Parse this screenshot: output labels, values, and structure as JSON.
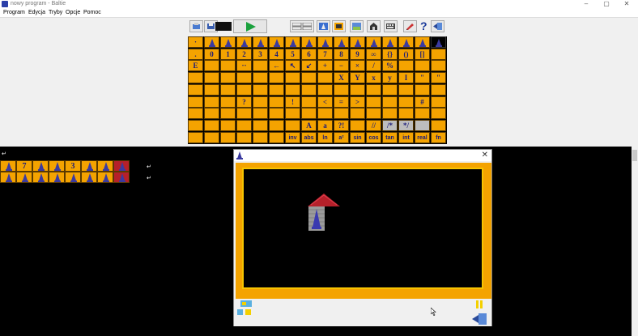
{
  "window": {
    "title": "nowy program - Baltie",
    "controls": [
      "–",
      "▢",
      "✕"
    ]
  },
  "menu": [
    "Program",
    "Edycja",
    "Tryby",
    "Opcje",
    "Pomoc"
  ],
  "toolbar": {
    "icons": [
      "open-icon",
      "save-icon",
      "mode-display-icon",
      "run-icon",
      "grid-icon",
      "grid-icon-2",
      "wizard-icon",
      "scene-icon",
      "world-icon",
      "house-icon",
      "keyboard-icon",
      "pencil-icon",
      "help-icon",
      "exit-icon"
    ]
  },
  "palette": {
    "rows": [
      [
        "·",
        "",
        "",
        "",
        "",
        "",
        "",
        "",
        "",
        "",
        "",
        "",
        "",
        "",
        "",
        ""
      ],
      [
        ".",
        "0",
        "1",
        "2",
        "3",
        "4",
        "5",
        "6",
        "7",
        "8",
        "9",
        "∞",
        "{}",
        "()",
        "[]",
        ""
      ],
      [
        "E",
        "",
        "",
        "··",
        "",
        "←",
        "↖",
        "↙",
        "+",
        "−",
        "×",
        "/",
        "%",
        "",
        "",
        ""
      ],
      [
        "",
        "",
        "",
        "",
        "",
        "",
        "",
        "",
        "",
        "X",
        "Y",
        "x",
        "y",
        "I",
        "\"",
        "\""
      ],
      [
        "",
        "",
        "",
        "",
        "",
        "",
        "",
        "",
        "",
        "",
        "",
        "",
        "",
        "",
        "",
        ""
      ],
      [
        "",
        "",
        "",
        "?",
        "",
        "",
        "!",
        "",
        "<",
        "=",
        ">",
        "",
        "",
        "",
        "#",
        ""
      ],
      [
        "",
        "",
        "",
        "",
        "",
        "",
        "",
        "",
        "",
        "",
        "",
        "",
        "",
        "",
        "",
        ""
      ],
      [
        "",
        "",
        "",
        "",
        "",
        "",
        "",
        "A",
        "a",
        "?!",
        "",
        "//",
        "/*",
        "*/",
        "",
        ""
      ],
      [
        "",
        "",
        "",
        "",
        "",
        "",
        "inv",
        "abs",
        "ln",
        "a²",
        "sin",
        "cos",
        "tan",
        "int",
        "real",
        "fn"
      ]
    ]
  },
  "program": {
    "line1": [
      "",
      "7",
      "",
      "",
      "3",
      "",
      "",
      ""
    ],
    "line2": [
      "",
      "",
      "",
      "",
      "",
      "",
      "",
      ""
    ]
  },
  "world": {
    "close": "✕"
  },
  "colors": {
    "tile": "#f4a300",
    "accent": "#1aa13d"
  }
}
